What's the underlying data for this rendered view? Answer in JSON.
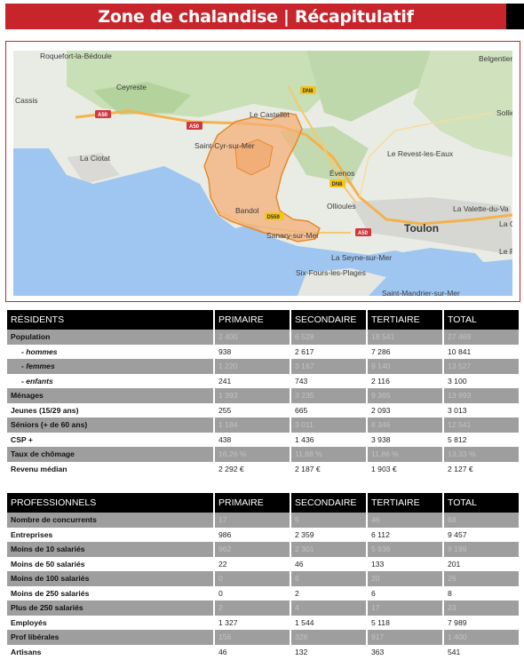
{
  "title": "Zone de chalandise | Récapitulatif",
  "map": {
    "places": {
      "roquefort": "Roquefort-la-Bédoule",
      "ceyreste": "Ceyreste",
      "cassis": "Cassis",
      "la_ciotat": "La Ciotat",
      "saint_cyr": "Saint-Cyr-sur-Mer",
      "le_castellet": "Le Castellet",
      "evenos": "Évenos",
      "le_revest": "Le Revest-les-Eaux",
      "ollioules": "Ollioules",
      "bandol": "Bandol",
      "sanary": "Sanary-sur-Mer",
      "la_seyne": "La Seyne-sur-Mer",
      "six_fours": "Six-Fours-les-Plages",
      "toulon": "Toulon",
      "la_valette": "La Valette-du-Va",
      "la_garde": "La G",
      "le_pradet": "Le P",
      "belgentier": "Belgentier",
      "sollies": "Sollié",
      "saint_mandrier": "Saint-Mandrier-sur-Mer"
    },
    "roads": {
      "a50": "A50",
      "dn8": "DN8",
      "d559": "D559"
    }
  },
  "residents": {
    "headers": [
      "RÉSIDENTS",
      "PRIMAIRE",
      "SECONDAIRE",
      "TERTIAIRE",
      "TOTAL"
    ],
    "rows": [
      {
        "label": "Population",
        "values": [
          "2 400",
          "6 528",
          "18 541",
          "27 469"
        ],
        "kind": "main",
        "shade": true
      },
      {
        "label": "- hommes",
        "values": [
          "938",
          "2 617",
          "7 286",
          "10 841"
        ],
        "kind": "sub",
        "shade": false
      },
      {
        "label": "- femmes",
        "values": [
          "1 220",
          "3 167",
          "9 140",
          "13 527"
        ],
        "kind": "sub",
        "shade": true
      },
      {
        "label": "- enfants",
        "values": [
          "241",
          "743",
          "2 116",
          "3 100"
        ],
        "kind": "sub",
        "shade": false
      },
      {
        "label": "Ménages",
        "values": [
          "1 393",
          "3 235",
          "9 365",
          "13 993"
        ],
        "kind": "main",
        "shade": true
      },
      {
        "label": "Jeunes (15/29 ans)",
        "values": [
          "255",
          "665",
          "2 093",
          "3 013"
        ],
        "kind": "main",
        "shade": false
      },
      {
        "label": "Séniors (+ de 60 ans)",
        "values": [
          "1 184",
          "3 011",
          "8 346",
          "12 541"
        ],
        "kind": "main",
        "shade": true
      },
      {
        "label": "CSP +",
        "values": [
          "438",
          "1 436",
          "3 938",
          "5 812"
        ],
        "kind": "main",
        "shade": false
      },
      {
        "label": "Taux de chômage",
        "values": [
          "16,26 %",
          "11,88 %",
          "11,86 %",
          "13,33 %"
        ],
        "kind": "main",
        "shade": true
      },
      {
        "label": "Revenu médian",
        "values": [
          "2 292 €",
          "2 187 €",
          "1 903 €",
          "2 127 €"
        ],
        "kind": "main",
        "shade": false
      }
    ]
  },
  "professionals": {
    "headers": [
      "PROFESSIONNELS",
      "PRIMAIRE",
      "SECONDAIRE",
      "TERTIAIRE",
      "TOTAL"
    ],
    "rows": [
      {
        "label": "Nombre de concurrents",
        "values": [
          "17",
          "5",
          "46",
          "68"
        ],
        "kind": "main",
        "shade": true
      },
      {
        "label": "Entreprises",
        "values": [
          "986",
          "2 359",
          "6 112",
          "9 457"
        ],
        "kind": "main",
        "shade": false
      },
      {
        "label": "Moins de 10 salariés",
        "values": [
          "962",
          "2 301",
          "5 936",
          "9 199"
        ],
        "kind": "main",
        "shade": true
      },
      {
        "label": "Moins de 50 salariés",
        "values": [
          "22",
          "46",
          "133",
          "201"
        ],
        "kind": "main",
        "shade": false
      },
      {
        "label": "Moins de 100 salariés",
        "values": [
          "0",
          "6",
          "20",
          "26"
        ],
        "kind": "main",
        "shade": true
      },
      {
        "label": "Moins de 250 salariés",
        "values": [
          "0",
          "2",
          "6",
          "8"
        ],
        "kind": "main",
        "shade": false
      },
      {
        "label": "Plus de 250 salariés",
        "values": [
          "2",
          "4",
          "17",
          "23"
        ],
        "kind": "main",
        "shade": true
      },
      {
        "label": "Employés",
        "values": [
          "1 327",
          "1 544",
          "5 118",
          "7 989"
        ],
        "kind": "main",
        "shade": false
      },
      {
        "label": "Prof libérales",
        "values": [
          "156",
          "328",
          "917",
          "1 400"
        ],
        "kind": "main",
        "shade": true
      },
      {
        "label": "Artisans",
        "values": [
          "46",
          "132",
          "363",
          "541"
        ],
        "kind": "main",
        "shade": false
      }
    ]
  }
}
